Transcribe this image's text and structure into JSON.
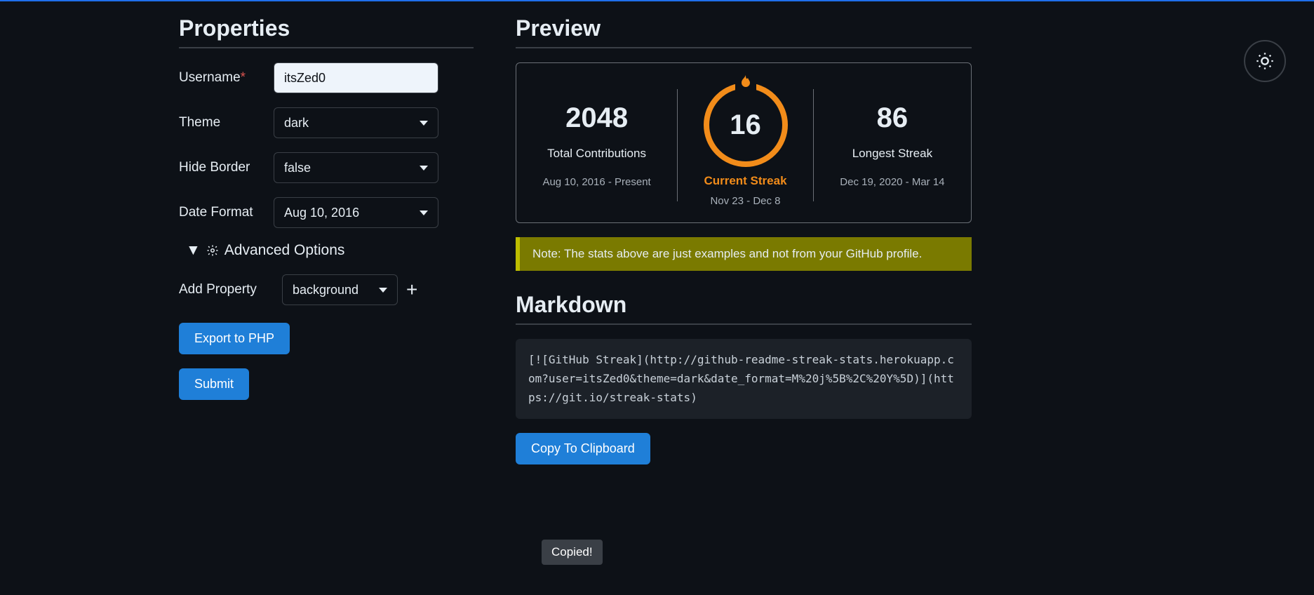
{
  "properties": {
    "heading": "Properties",
    "username_label": "Username",
    "username_value": "itsZed0",
    "theme_label": "Theme",
    "theme_value": "dark",
    "hide_border_label": "Hide Border",
    "hide_border_value": "false",
    "date_format_label": "Date Format",
    "date_format_value": "Aug 10, 2016",
    "advanced_label": "Advanced Options",
    "add_property_label": "Add Property",
    "add_property_value": "background",
    "export_btn": "Export to PHP",
    "submit_btn": "Submit"
  },
  "preview": {
    "heading": "Preview",
    "total_value": "2048",
    "total_label": "Total Contributions",
    "total_range": "Aug 10, 2016 - Present",
    "current_value": "16",
    "current_label": "Current Streak",
    "current_range": "Nov 23 - Dec 8",
    "longest_value": "86",
    "longest_label": "Longest Streak",
    "longest_range": "Dec 19, 2020 - Mar 14",
    "note": "Note: The stats above are just examples and not from your GitHub profile."
  },
  "markdown": {
    "heading": "Markdown",
    "code": "[![GitHub Streak](http://github-readme-streak-stats.herokuapp.com?user=itsZed0&theme=dark&date_format=M%20j%5B%2C%20Y%5D)](https://git.io/streak-stats)",
    "copy_btn": "Copy To Clipboard",
    "tooltip": "Copied!"
  }
}
